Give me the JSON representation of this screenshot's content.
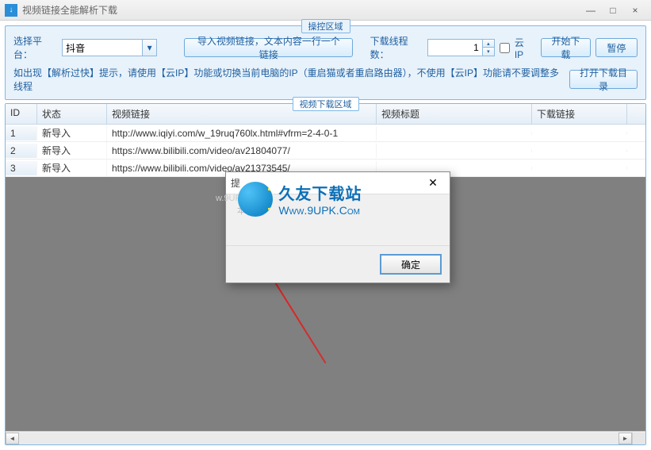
{
  "window": {
    "title": "视频链接全能解析下载",
    "minimize": "—",
    "maximize": "□",
    "close": "×"
  },
  "controlArea": {
    "legend": "操控区域",
    "platformLabel": "选择平台：",
    "platformValue": "抖音",
    "importBtn": "导入视频链接，文本内容一行一个链接",
    "threadLabel": "下载线程数：",
    "threadValue": "1",
    "cloudIpLabel": "云IP",
    "startBtn": "开始下载",
    "pauseBtn": "暂停",
    "tipText": "如出现【解析过快】提示，请使用【云IP】功能或切换当前电脑的IP（重启猫或者重启路由器），不使用【云IP】功能请不要调整多线程",
    "openDirBtn": "打开下载目录"
  },
  "tableArea": {
    "legend": "视频下载区域",
    "headers": {
      "id": "ID",
      "status": "状态",
      "link": "视频链接",
      "title": "视频标题",
      "dl": "下载链接"
    },
    "rows": [
      {
        "id": "1",
        "status": "新导入",
        "link": "http://www.iqiyi.com/w_19ruq760lx.html#vfrm=2-4-0-1",
        "title": "",
        "dl": ""
      },
      {
        "id": "2",
        "status": "新导入",
        "link": "https://www.bilibili.com/video/av21804077/",
        "title": "",
        "dl": ""
      },
      {
        "id": "3",
        "status": "新导入",
        "link": "https://www.bilibili.com/video/av21373545/",
        "title": "",
        "dl": ""
      }
    ]
  },
  "dialog": {
    "title": "提",
    "bodyFaint": "本次",
    "ok": "确定"
  },
  "watermark": {
    "line1": "久友下载站",
    "line2": "Www.9UPK.Com",
    "faint": "w.9UPK.co"
  },
  "scroll": {
    "left": "◄",
    "right": "►"
  }
}
